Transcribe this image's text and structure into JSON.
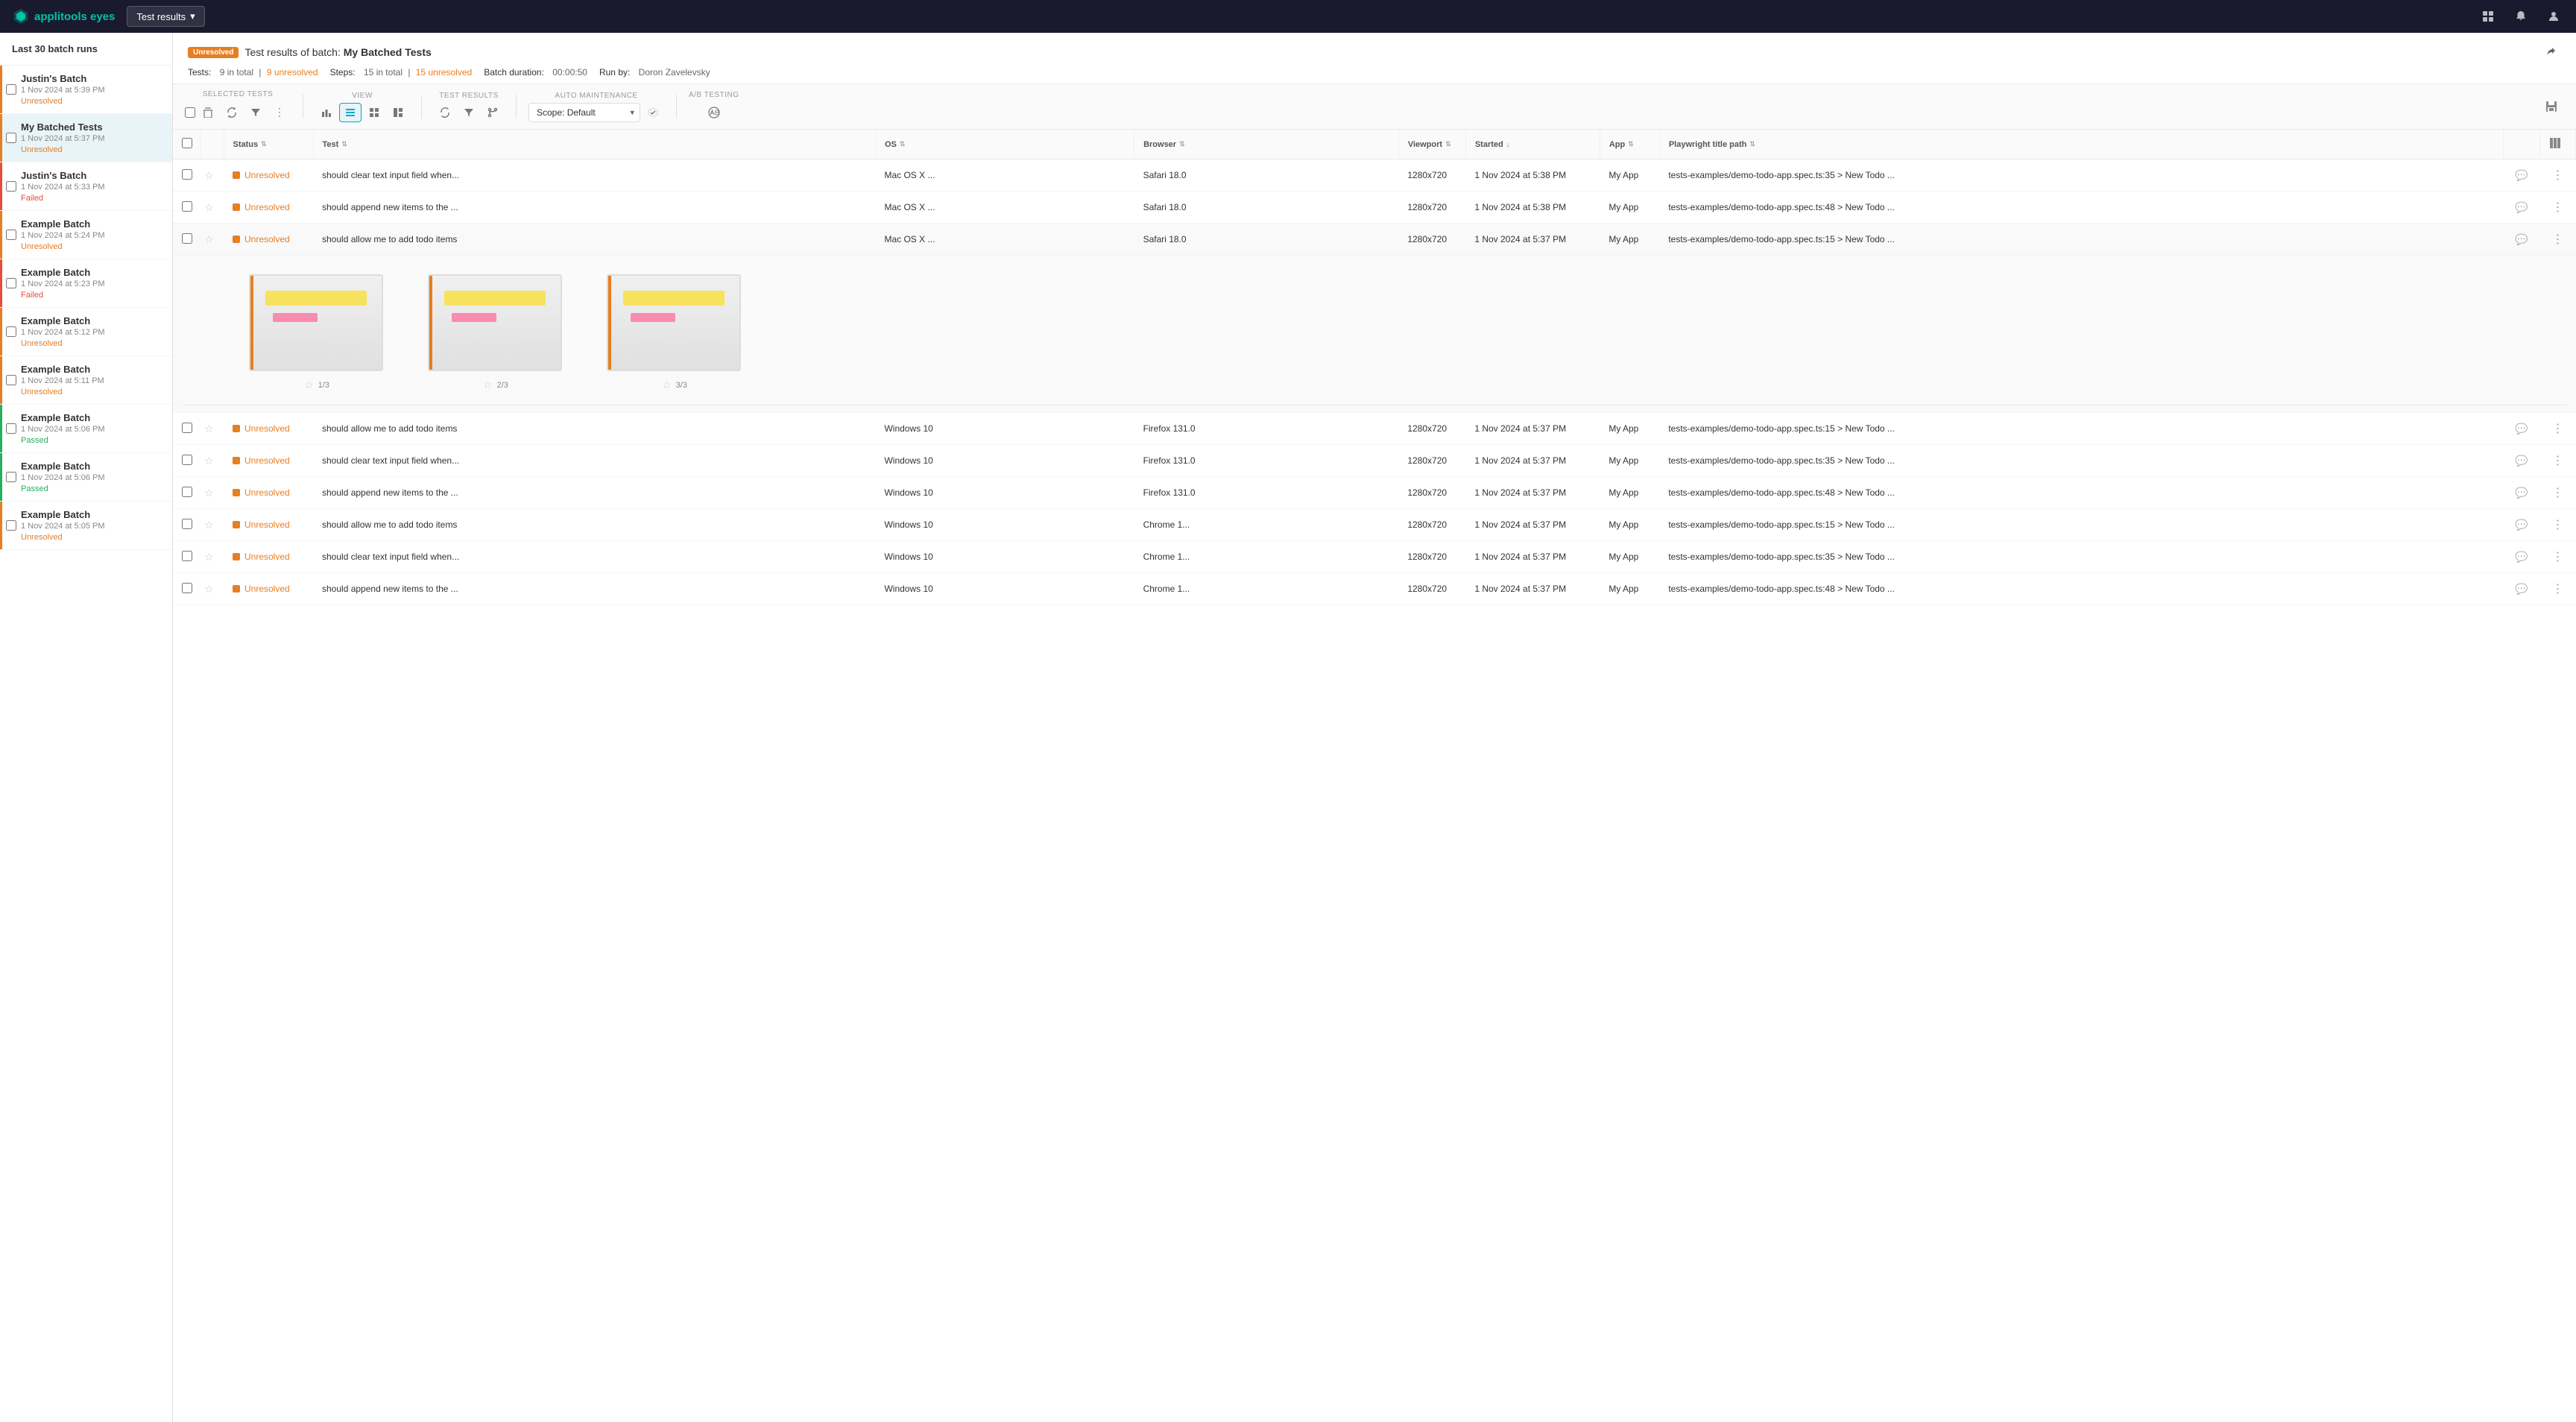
{
  "topNav": {
    "logo": "applitools eyes",
    "dropdown": "Test results",
    "icons": [
      "grid-icon",
      "bell-icon",
      "user-icon"
    ]
  },
  "sidebar": {
    "header": "Last 30 batch runs",
    "items": [
      {
        "id": 1,
        "name": "Justin's Batch",
        "date": "1 Nov 2024 at 5:39 PM",
        "status": "Unresolved",
        "statusType": "unresolved",
        "indicatorType": "orange"
      },
      {
        "id": 2,
        "name": "My Batched Tests",
        "date": "1 Nov 2024 at 5:37 PM",
        "status": "Unresolved",
        "statusType": "unresolved",
        "indicatorType": "orange",
        "active": true
      },
      {
        "id": 3,
        "name": "Justin's Batch",
        "date": "1 Nov 2024 at 5:33 PM",
        "status": "Failed",
        "statusType": "failed",
        "indicatorType": "red"
      },
      {
        "id": 4,
        "name": "Example Batch",
        "date": "1 Nov 2024 at 5:24 PM",
        "status": "Unresolved",
        "statusType": "unresolved",
        "indicatorType": "orange"
      },
      {
        "id": 5,
        "name": "Example Batch",
        "date": "1 Nov 2024 at 5:23 PM",
        "status": "Failed",
        "statusType": "failed",
        "indicatorType": "red"
      },
      {
        "id": 6,
        "name": "Example Batch",
        "date": "1 Nov 2024 at 5:12 PM",
        "status": "Unresolved",
        "statusType": "unresolved",
        "indicatorType": "orange"
      },
      {
        "id": 7,
        "name": "Example Batch",
        "date": "1 Nov 2024 at 5:11 PM",
        "status": "Unresolved",
        "statusType": "unresolved",
        "indicatorType": "orange"
      },
      {
        "id": 8,
        "name": "Example Batch",
        "date": "1 Nov 2024 at 5:06 PM",
        "status": "Passed",
        "statusType": "passed",
        "indicatorType": "green"
      },
      {
        "id": 9,
        "name": "Example Batch",
        "date": "1 Nov 2024 at 5:06 PM",
        "status": "Passed",
        "statusType": "passed",
        "indicatorType": "green"
      },
      {
        "id": 10,
        "name": "Example Batch",
        "date": "1 Nov 2024 at 5:05 PM",
        "status": "Unresolved",
        "statusType": "unresolved",
        "indicatorType": "orange"
      }
    ]
  },
  "batchHeader": {
    "unresolvedLabel": "Unresolved",
    "titlePrefix": "Test results of batch:",
    "batchName": "My Batched Tests",
    "testsLabel": "Tests:",
    "testsTotal": "9 in total",
    "testsUnresolved": "9 unresolved",
    "stepsLabel": "Steps:",
    "stepsTotal": "15 in total",
    "stepsUnresolved": "15 unresolved",
    "durationLabel": "Batch duration:",
    "durationValue": "00:00:50",
    "runByLabel": "Run by:",
    "runByValue": "Doron Zavelevsky"
  },
  "toolbar": {
    "groups": [
      {
        "label": "SELECTED TESTS",
        "buttons": [
          "checkbox-icon",
          "delete-icon",
          "refresh-icon",
          "filter-icon",
          "more-icon"
        ]
      },
      {
        "label": "VIEW",
        "buttons": [
          "chart-icon",
          "list-icon",
          "grid-icon",
          "panel-icon"
        ]
      },
      {
        "label": "TEST RESULTS",
        "buttons": [
          "refresh-icon",
          "filter-icon",
          "branch-icon"
        ]
      }
    ],
    "autoMaintenance": {
      "label": "AUTO MAINTENANCE",
      "scopeLabel": "Scope: Default"
    },
    "abTesting": {
      "label": "A/B TESTING",
      "buttonIcon": "ab-icon"
    }
  },
  "table": {
    "columns": [
      "",
      "",
      "Status",
      "Test",
      "OS",
      "Browser",
      "Viewport",
      "Started",
      "App",
      "Playwright title path",
      "",
      ""
    ],
    "rows": [
      {
        "id": "r1",
        "status": "Unresolved",
        "test": "should clear text input field when...",
        "os": "Mac OS X ...",
        "browser": "Safari 18.0",
        "viewport": "1280x720",
        "started": "1 Nov 2024 at 5:38 PM",
        "app": "My App",
        "path": "tests-examples/demo-todo-app.spec.ts:35 > New Todo ...",
        "expanded": false
      },
      {
        "id": "r2",
        "status": "Unresolved",
        "test": "should append new items to the ...",
        "os": "Mac OS X ...",
        "browser": "Safari 18.0",
        "viewport": "1280x720",
        "started": "1 Nov 2024 at 5:38 PM",
        "app": "My App",
        "path": "tests-examples/demo-todo-app.spec.ts:48 > New Todo ...",
        "expanded": false
      },
      {
        "id": "r3",
        "status": "Unresolved",
        "test": "should allow me to add todo items",
        "os": "Mac OS X ...",
        "browser": "Safari 18.0",
        "viewport": "1280x720",
        "started": "1 Nov 2024 at 5:37 PM",
        "app": "My App",
        "path": "tests-examples/demo-todo-app.spec.ts:15 > New Todo ...",
        "expanded": true,
        "previews": [
          {
            "label": "1/3"
          },
          {
            "label": "2/3"
          },
          {
            "label": "3/3"
          }
        ]
      },
      {
        "id": "r4",
        "status": "Unresolved",
        "test": "should allow me to add todo items",
        "os": "Windows 10",
        "browser": "Firefox 131.0",
        "viewport": "1280x720",
        "started": "1 Nov 2024 at 5:37 PM",
        "app": "My App",
        "path": "tests-examples/demo-todo-app.spec.ts:15 > New Todo ...",
        "expanded": false
      },
      {
        "id": "r5",
        "status": "Unresolved",
        "test": "should clear text input field when...",
        "os": "Windows 10",
        "browser": "Firefox 131.0",
        "viewport": "1280x720",
        "started": "1 Nov 2024 at 5:37 PM",
        "app": "My App",
        "path": "tests-examples/demo-todo-app.spec.ts:35 > New Todo ...",
        "expanded": false
      },
      {
        "id": "r6",
        "status": "Unresolved",
        "test": "should append new items to the ...",
        "os": "Windows 10",
        "browser": "Firefox 131.0",
        "viewport": "1280x720",
        "started": "1 Nov 2024 at 5:37 PM",
        "app": "My App",
        "path": "tests-examples/demo-todo-app.spec.ts:48 > New Todo ...",
        "expanded": false
      },
      {
        "id": "r7",
        "status": "Unresolved",
        "test": "should allow me to add todo items",
        "os": "Windows 10",
        "browser": "Chrome 1...",
        "viewport": "1280x720",
        "started": "1 Nov 2024 at 5:37 PM",
        "app": "My App",
        "path": "tests-examples/demo-todo-app.spec.ts:15 > New Todo ...",
        "expanded": false
      },
      {
        "id": "r8",
        "status": "Unresolved",
        "test": "should clear text input field when...",
        "os": "Windows 10",
        "browser": "Chrome 1...",
        "viewport": "1280x720",
        "started": "1 Nov 2024 at 5:37 PM",
        "app": "My App",
        "path": "tests-examples/demo-todo-app.spec.ts:35 > New Todo ...",
        "expanded": false
      },
      {
        "id": "r9",
        "status": "Unresolved",
        "test": "should append new items to the ...",
        "os": "Windows 10",
        "browser": "Chrome 1...",
        "viewport": "1280x720",
        "started": "1 Nov 2024 at 5:37 PM",
        "app": "My App",
        "path": "tests-examples/demo-todo-app.spec.ts:48 > New Todo ...",
        "expanded": false
      }
    ]
  },
  "icons": {
    "chevron-down": "▾",
    "star-empty": "☆",
    "star-filled": "★",
    "comment": "💬",
    "more-dots": "⋮",
    "check": "✓",
    "not-equal": "≠",
    "share": "⤢",
    "save": "💾",
    "bell": "🔔",
    "user": "👤",
    "grid": "⊞",
    "list": "≡",
    "chart": "📊",
    "filter": "⊿",
    "refresh": "↻",
    "delete": "🗑",
    "branch": "⑂",
    "panel": "▣"
  }
}
